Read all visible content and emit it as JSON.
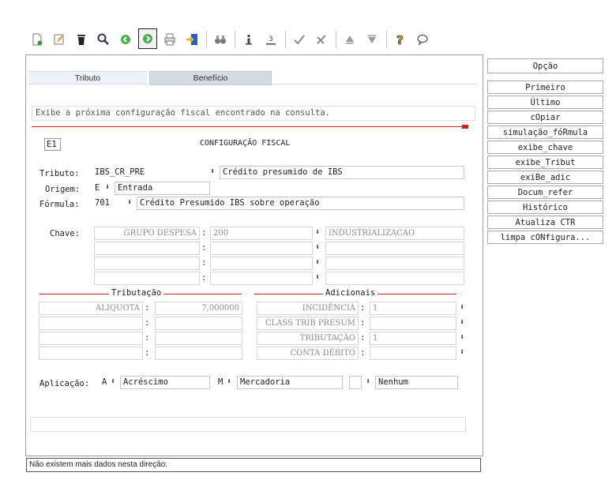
{
  "tabs": {
    "tributo": "Tributo",
    "beneficio": "Benefício"
  },
  "message": "Exibe a próxima configuração fiscal encontrado na consulta.",
  "header": {
    "code": "E1",
    "title": "CONFIGURAÇÃO FISCAL"
  },
  "form": {
    "tributo_label": "Tributo:",
    "tributo_code": "IBS_CR_PRE",
    "tributo_desc": "Crédito presumido de IBS",
    "origem_label": "Origem:",
    "origem_code": "E",
    "origem_desc": "Entrada",
    "formula_label": "Fórmula:",
    "formula_code": "701",
    "formula_desc": "Crédito Presumido IBS sobre operação"
  },
  "chave": {
    "label": "Chave:",
    "rows": [
      {
        "name": "GRUPO DESPESA",
        "value": "200",
        "desc": "INDUSTRIALIZACAO"
      },
      {
        "name": "",
        "value": "",
        "desc": ""
      },
      {
        "name": "",
        "value": "",
        "desc": ""
      },
      {
        "name": "",
        "value": "",
        "desc": ""
      }
    ]
  },
  "tributacao": {
    "title": "Tributação",
    "rows": [
      {
        "name": "ALIQUOTA",
        "value": "7,000000"
      },
      {
        "name": "",
        "value": ""
      },
      {
        "name": "",
        "value": ""
      },
      {
        "name": "",
        "value": ""
      }
    ]
  },
  "adicionais": {
    "title": "Adicionais",
    "rows": [
      {
        "name": "INCIDÊNCIA",
        "value": "1"
      },
      {
        "name": "CLASS TRIB PRESUM",
        "value": ""
      },
      {
        "name": "TRIBUTAÇÃO",
        "value": "1"
      },
      {
        "name": "CONTA DÉBITO",
        "value": ""
      }
    ]
  },
  "aplicacao": {
    "label": "Aplicação:",
    "f1_code": "A",
    "f1_desc": "Acréscimo",
    "f2_code": "M",
    "f2_desc": "Mercadoria",
    "f3_code": "",
    "f3_desc": "Nenhum"
  },
  "sidebar": {
    "header": "Opção",
    "buttons": [
      "Primeiro",
      "Último",
      "cOpiar",
      "simulação_fóRmula",
      "exibe_chave",
      "exibe_Tribut",
      "exiBe_adic",
      "Docum_refer",
      "Histórico",
      "Atualiza CTR",
      "limpa cONfigura..."
    ]
  },
  "status": "Não existem mais dados nesta direção.",
  "colors": {
    "accent_red": "#cc2222",
    "border": "#9c9c9c",
    "tab_active": "#d6dae1"
  }
}
